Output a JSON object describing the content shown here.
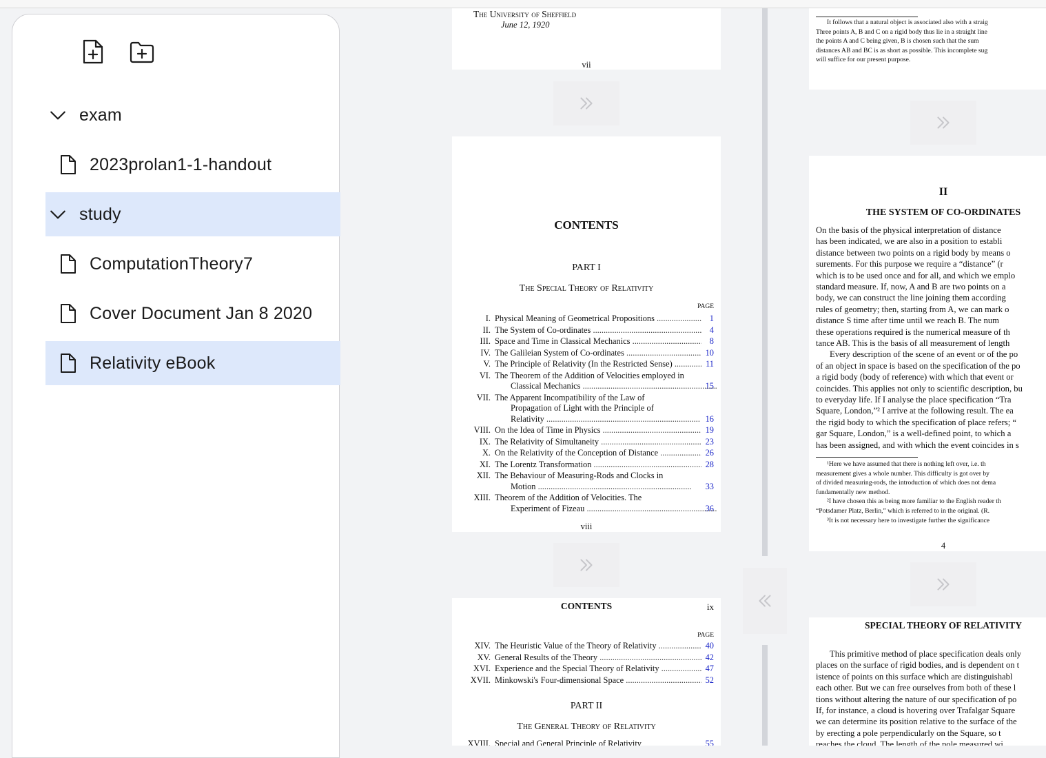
{
  "sidebar": {
    "new_file_icon": "file-plus-icon",
    "new_folder_icon": "folder-plus-icon",
    "items": [
      {
        "label": "exam",
        "type": "folder",
        "expanded": true,
        "selected": false
      },
      {
        "label": "2023prolan1-1-handout",
        "type": "file",
        "selected": false
      },
      {
        "label": "study",
        "type": "folder",
        "expanded": true,
        "selected": true
      },
      {
        "label": "ComputationTheory7",
        "type": "file",
        "selected": false
      },
      {
        "label": "Cover Document Jan 8 2020",
        "type": "file",
        "selected": false
      },
      {
        "label": "Relativity eBook",
        "type": "file",
        "selected": true
      }
    ]
  },
  "pages": {
    "page_vii": {
      "signature_university": "The University of Sheffield",
      "signature_date": "June 12, 1920",
      "page_number": "vii"
    },
    "page_viii": {
      "heading": "CONTENTS",
      "part": "PART I",
      "part_title": "The Special Theory of Relativity",
      "page_col_label": "PAGE",
      "entries": [
        {
          "num": "I.",
          "lines": [
            "Physical Meaning of Geometrical Propositions"
          ],
          "page": "1"
        },
        {
          "num": "II.",
          "lines": [
            "The System of Co-ordinates"
          ],
          "page": "4"
        },
        {
          "num": "III.",
          "lines": [
            "Space and Time in Classical Mechanics"
          ],
          "page": "8"
        },
        {
          "num": "IV.",
          "lines": [
            "The Galileian System of Co-ordinates"
          ],
          "page": "10"
        },
        {
          "num": "V.",
          "lines": [
            "The Principle of Relativity (In the Restricted Sense)"
          ],
          "page": "11"
        },
        {
          "num": "VI.",
          "lines": [
            "The Theorem of the Addition of Velocities employed in",
            "Classical Mechanics"
          ],
          "page": "15"
        },
        {
          "num": "VII.",
          "lines": [
            "The Apparent Incompatibility of the Law of",
            "Propagation of Light with the Principle of",
            "Relativity"
          ],
          "page": "16"
        },
        {
          "num": "VIII.",
          "lines": [
            "On the Idea of Time in Physics"
          ],
          "page": "19"
        },
        {
          "num": "IX.",
          "lines": [
            "The Relativity of Simultaneity"
          ],
          "page": "23"
        },
        {
          "num": "X.",
          "lines": [
            "On the Relativity of the Conception of Distance"
          ],
          "page": "26"
        },
        {
          "num": "XI.",
          "lines": [
            "The Lorentz Transformation"
          ],
          "page": "28"
        },
        {
          "num": "XII.",
          "lines": [
            "The Behaviour of Measuring-Rods and Clocks in",
            "Motion"
          ],
          "page": "33"
        },
        {
          "num": "XIII.",
          "lines": [
            "Theorem of the Addition of Velocities. The",
            "Experiment of Fizeau"
          ],
          "page": "36"
        }
      ],
      "page_number": "viii"
    },
    "page_ix": {
      "heading": "CONTENTS",
      "page_number": "ix",
      "page_col_label": "PAGE",
      "entries": [
        {
          "num": "XIV.",
          "lines": [
            "The Heuristic Value of the Theory of Relativity"
          ],
          "page": "40"
        },
        {
          "num": "XV.",
          "lines": [
            "General Results of the Theory"
          ],
          "page": "42"
        },
        {
          "num": "XVI.",
          "lines": [
            "Experience and the Special Theory of Relativity"
          ],
          "page": "47"
        },
        {
          "num": "XVII.",
          "lines": [
            "Minkowski's Four-dimensional Space"
          ],
          "page": "52"
        }
      ],
      "part": "PART II",
      "part_title": "The General Theory of Relativity",
      "partial_entry": {
        "num": "XVIII.",
        "text": "Special and General Principle of Relativity",
        "page": "55"
      }
    },
    "page_3_footnote": {
      "lines": [
        "It follows that a natural object is associated also with a straig",
        "Three points A, B and C on a rigid body thus lie in a straight line",
        "the points A and C being given, B is chosen such that the sum",
        "distances AB and BC is as short as possible. This incomplete sug",
        "will suffice for our present purpose."
      ]
    },
    "page_4": {
      "chapter_num": "II",
      "chapter_title": "THE SYSTEM OF CO-ORDINATES",
      "body": [
        "On the basis of the physical interpretation of distance",
        "has been indicated, we are also in a position to establi",
        "distance between two points on a rigid body by means o",
        "surements. For this purpose we require a “distance” (r",
        "which is to be used once and for all, and which we emplo",
        "standard measure. If, now, A and B are two points on a",
        "body, we can construct the line joining them according",
        "rules of geometry; then, starting from A, we can mark o",
        "distance S time after time until we reach B. The num",
        "these operations required is the numerical measure of th",
        "tance AB. This is the basis of all measurement of length",
        "Every description of the scene of an event or of the po",
        "of an object in space is based on the specification of the po",
        "a rigid body (body of reference) with which that event or",
        "coincides. This applies not only to scientific description, bu",
        "to everyday life. If I analyse the place specification “Tra",
        "Square, London,”² I arrive at the following result. The ea",
        "the rigid body to which the specification of place refers; “",
        "gar Square, London,” is a well-defined point, to which a",
        "has been assigned, and with which the event coincides in s"
      ],
      "footnotes": [
        "¹Here we have assumed that there is nothing left over, i.e. th",
        "measurement gives a whole number. This difficulty is got over by",
        "of divided measuring-rods, the introduction of which does not dema",
        "fundamentally new method.",
        "²I have chosen this as being more familiar to the English reader th",
        "“Potsdamer Platz, Berlin,” which is referred to in the original. (R.",
        "³It is not necessary here to investigate further the significance"
      ],
      "page_number": "4"
    },
    "page_5": {
      "running_head": "SPECIAL THEORY OF RELATIVITY",
      "body": [
        "This primitive method of place specification deals only",
        "places on the surface of rigid bodies, and is dependent on t",
        "istence of points on this surface which are distinguishabl",
        "each other. But we can free ourselves from both of these l",
        "tions without altering the nature of our specification of po",
        "If, for instance, a cloud is hovering over Trafalgar Square",
        "we can determine its position relative to the surface of the",
        "by erecting a pole perpendicularly on the Square, so t",
        "reaches the cloud. The length of the pole measured wi"
      ]
    }
  },
  "nav": {
    "next_icon": "chevrons-right-icon",
    "prev_icon": "chevrons-left-icon"
  }
}
